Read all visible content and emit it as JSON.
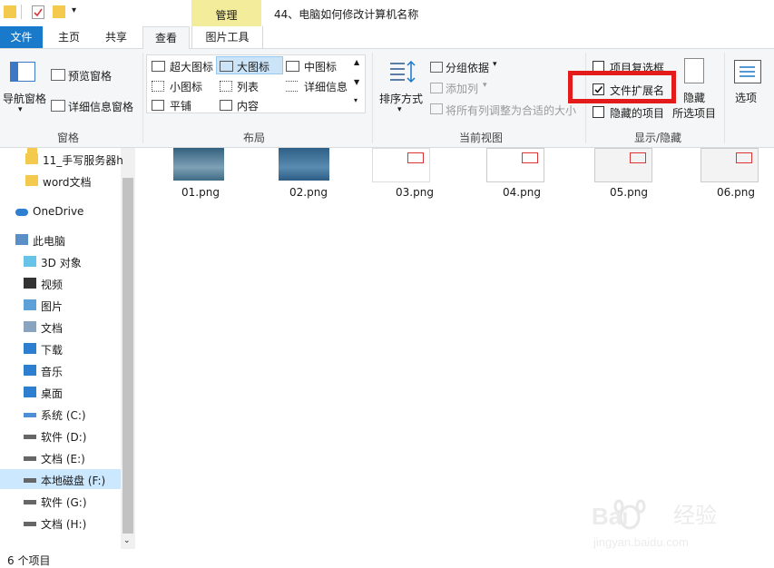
{
  "window": {
    "title": "44、电脑如何修改计算机名称",
    "context_tab": "管理"
  },
  "tabs": {
    "file": "文件",
    "home": "主页",
    "share": "共享",
    "view": "查看",
    "picture_tools": "图片工具"
  },
  "ribbon": {
    "panes": {
      "nav_pane": "导航窗格",
      "preview_pane": "预览窗格",
      "details_pane": "详细信息窗格",
      "group": "窗格"
    },
    "layout": {
      "extra_large": "超大图标",
      "large": "大图标",
      "medium": "中图标",
      "small": "小图标",
      "list": "列表",
      "details": "详细信息",
      "tiles": "平铺",
      "content": "内容",
      "group": "布局"
    },
    "current_view": {
      "sort_by": "排序方式",
      "group_by": "分组依据",
      "add_columns": "添加列",
      "size_all_columns": "将所有列调整为合适的大小",
      "group": "当前视图"
    },
    "show_hide": {
      "item_checkboxes": "项目复选框",
      "file_name_extensions": "文件扩展名",
      "hidden_items": "隐藏的项目",
      "hide_selected": "隐藏",
      "selected_items": "所选项目",
      "group": "显示/隐藏"
    },
    "options": "选项"
  },
  "sidebar": {
    "items": [
      {
        "label": "11_手写服务器h",
        "icon": "folder-icon"
      },
      {
        "label": "word文档",
        "icon": "folder-icon"
      },
      {
        "label": "OneDrive",
        "icon": "cloud-icon"
      },
      {
        "label": "此电脑",
        "icon": "computer-icon"
      },
      {
        "label": "3D 对象",
        "icon": "cube-icon"
      },
      {
        "label": "视频",
        "icon": "video-icon"
      },
      {
        "label": "图片",
        "icon": "picture-icon"
      },
      {
        "label": "文档",
        "icon": "document-icon"
      },
      {
        "label": "下载",
        "icon": "download-icon"
      },
      {
        "label": "音乐",
        "icon": "music-icon"
      },
      {
        "label": "桌面",
        "icon": "desktop-icon"
      },
      {
        "label": "系统 (C:)",
        "icon": "windows-drive-icon"
      },
      {
        "label": "软件 (D:)",
        "icon": "drive-icon"
      },
      {
        "label": "文档 (E:)",
        "icon": "drive-icon"
      },
      {
        "label": "本地磁盘 (F:)",
        "icon": "drive-icon"
      },
      {
        "label": "软件 (G:)",
        "icon": "drive-icon"
      },
      {
        "label": "文档 (H:)",
        "icon": "drive-icon"
      }
    ]
  },
  "files": [
    {
      "name": "01.png"
    },
    {
      "name": "02.png"
    },
    {
      "name": "03.png"
    },
    {
      "name": "04.png"
    },
    {
      "name": "05.png"
    },
    {
      "name": "06.png"
    }
  ],
  "status": {
    "item_count": "6 个项目"
  },
  "checkbox_state": {
    "item_checkboxes": false,
    "file_name_extensions": true,
    "hidden_items": false
  },
  "colors": {
    "file_tab": "#1979ca",
    "context_tab": "#f3ec9a",
    "highlight": "#e41b1b",
    "selection": "#cce8ff"
  }
}
